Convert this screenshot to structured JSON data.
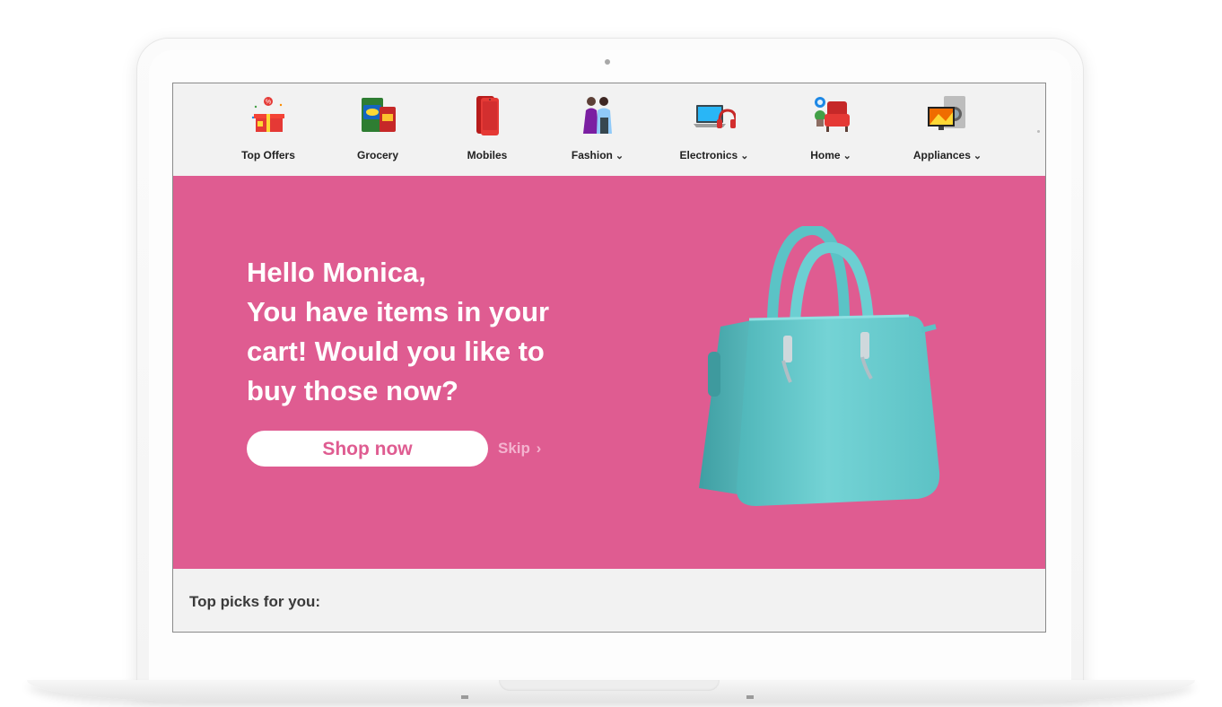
{
  "nav": {
    "items": [
      {
        "label": "Top Offers",
        "has_dropdown": false,
        "icon": "gift-icon"
      },
      {
        "label": "Grocery",
        "has_dropdown": false,
        "icon": "grocery-icon"
      },
      {
        "label": "Mobiles",
        "has_dropdown": false,
        "icon": "mobile-phone-icon"
      },
      {
        "label": "Fashion",
        "has_dropdown": true,
        "icon": "fashion-models-icon"
      },
      {
        "label": "Electronics",
        "has_dropdown": true,
        "icon": "laptop-headphones-icon"
      },
      {
        "label": "Home",
        "has_dropdown": true,
        "icon": "armchair-plant-icon"
      },
      {
        "label": "Appliances",
        "has_dropdown": true,
        "icon": "tv-washing-machine-icon"
      }
    ]
  },
  "banner": {
    "greeting_lines": [
      "Hello Monica,",
      "You have items in your",
      "cart! Would you like to",
      "buy those now?"
    ],
    "cta_label": "Shop now",
    "skip_label": "Skip",
    "product_image": "handbag-image"
  },
  "section": {
    "title": "Top picks for you:"
  },
  "colors": {
    "banner_bg": "#df5c91",
    "bag": "#6fd1d3",
    "page_bg": "#f2f2f2"
  }
}
